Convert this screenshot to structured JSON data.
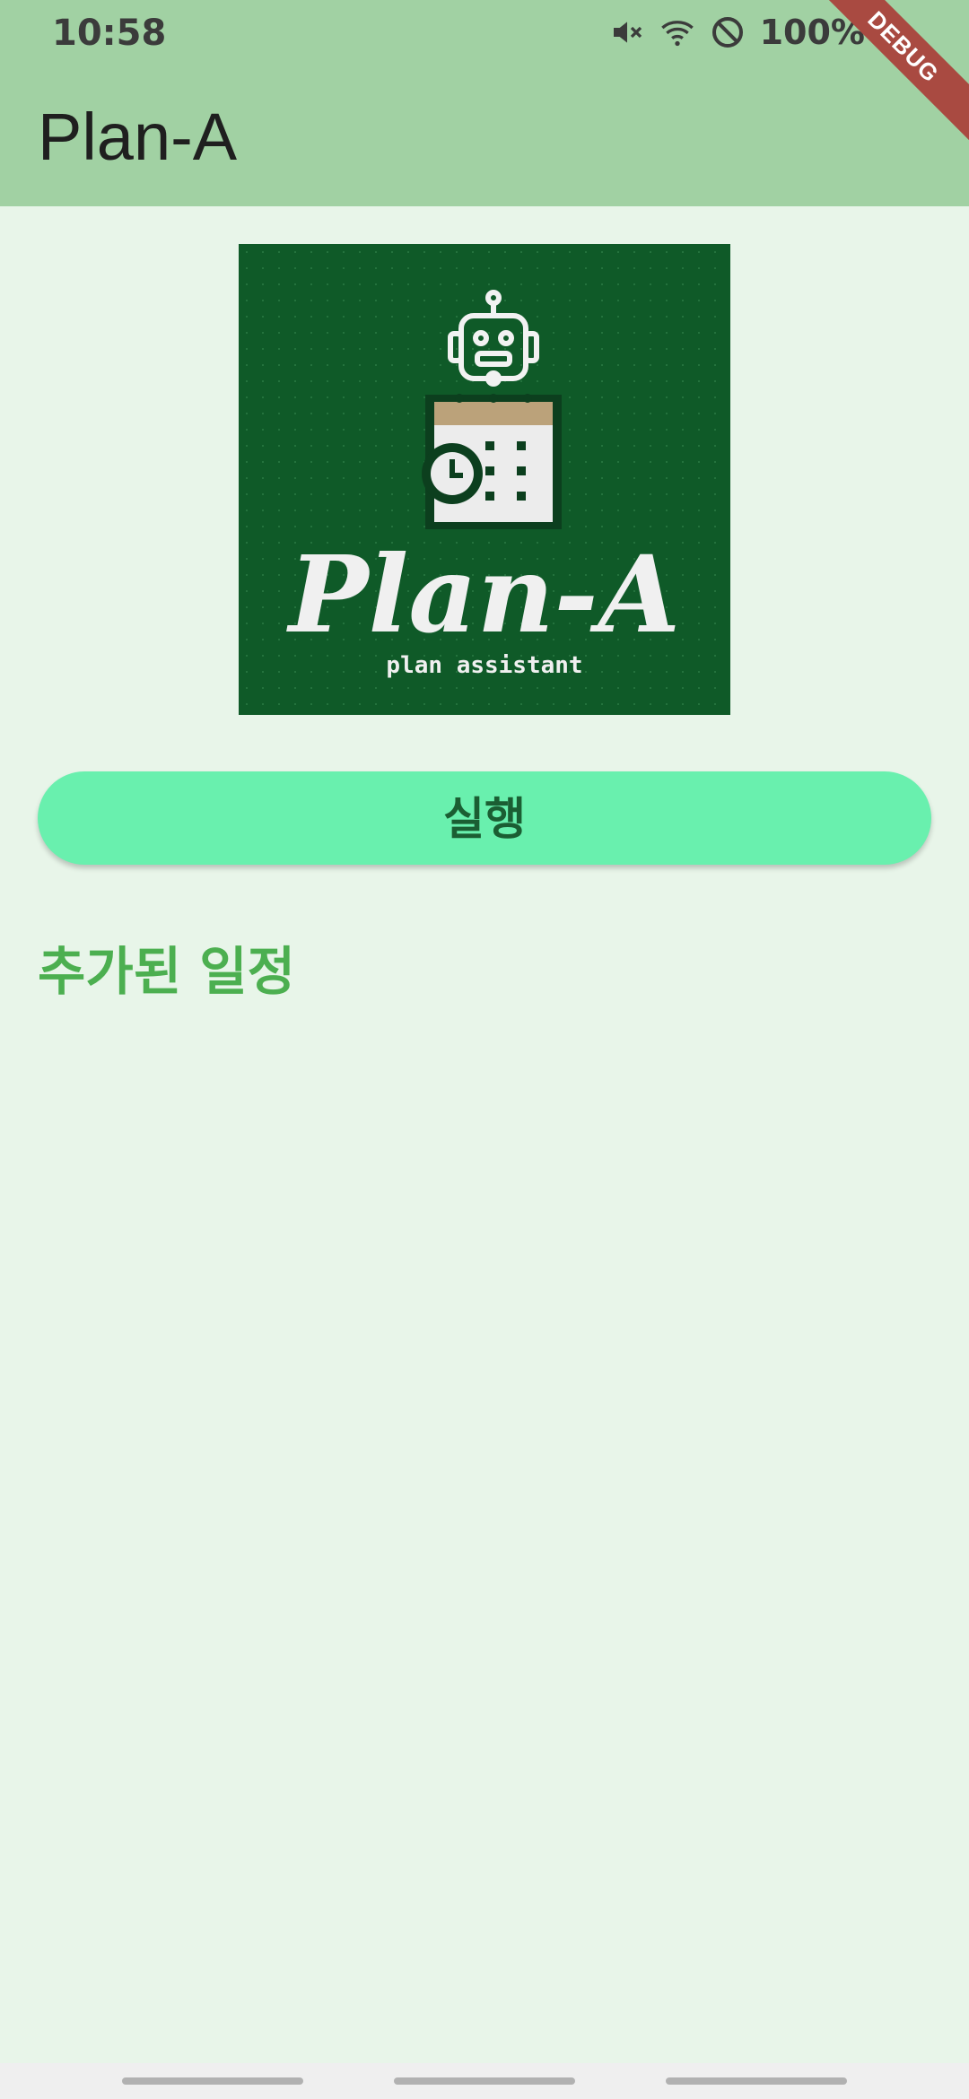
{
  "status_bar": {
    "time": "10:58",
    "battery": "100%",
    "icons": [
      "mute-icon",
      "wifi-icon",
      "do-not-disturb-icon",
      "battery-icon"
    ]
  },
  "debug_banner": "DEBUG",
  "app_bar": {
    "title": "Plan-A"
  },
  "logo": {
    "name": "Plan-A",
    "tagline": "plan assistant"
  },
  "main": {
    "run_button_label": "실행",
    "section_title": "추가된 일정"
  },
  "colors": {
    "app_bar": "#a1d1a3",
    "background": "#e8f5e9",
    "button": "#69f0ae",
    "section_title": "#4caf50",
    "logo_background": "#0f5a28"
  }
}
